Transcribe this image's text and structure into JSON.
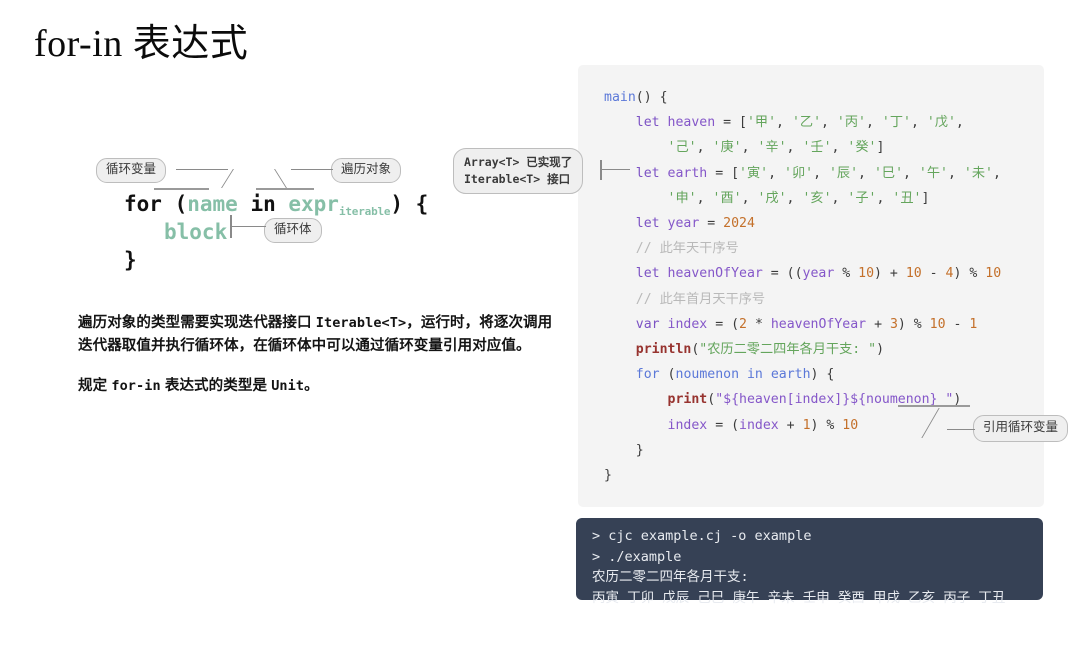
{
  "slide": {
    "title": "for-in 表达式"
  },
  "syntax_diagram": {
    "line1_pre": "for (",
    "line1_name": "name",
    "line1_mid": " in ",
    "line1_expr": "expr",
    "line1_sub": "iterable",
    "line1_post": ") {",
    "line2_block": "block",
    "line3_close": "}",
    "pill_loop_variable": "循环变量",
    "pill_iterable_object": "遍历对象",
    "pill_loop_body": "循环体"
  },
  "explanation": {
    "paragraph1_a": "遍历对象的类型需要实现迭代器接口 ",
    "paragraph1_mono": "Iterable<T>",
    "paragraph1_b": "，运行时，将逐次调用迭代器取值并执行循环体，在循环体中可以通过循环变量引用对应值。",
    "paragraph2_a": "规定 ",
    "paragraph2_mono1": "for-in",
    "paragraph2_b": " 表达式的类型是 ",
    "paragraph2_mono2": "Unit",
    "paragraph2_c": "。"
  },
  "annotations": {
    "array_note_line1": "Array<T> 已实现了",
    "array_note_line2": "Iterable<T> 接口",
    "ref_loop_variable": "引用循环变量"
  },
  "code": {
    "language": "cangjie",
    "lines": [
      "main() {",
      "    let heaven = ['甲', '乙', '丙', '丁', '戊',",
      "        '己', '庚', '辛', '壬', '癸']",
      "    let earth = ['寅', '卯', '辰', '巳', '午', '未',",
      "        '申', '酉', '戌', '亥', '子', '丑']",
      "    let year = 2024",
      "    // 此年天干序号",
      "    let heavenOfYear = ((year % 10) + 10 - 4) % 10",
      "    // 此年首月天干序号",
      "    var index = (2 * heavenOfYear + 3) % 10 - 1",
      "    println(\"农历二零二四年各月干支: \")",
      "    for (noumenon in earth) {",
      "        print(\"${heaven[index]}${noumenon} \")",
      "        index = (index + 1) % 10",
      "    }",
      "}"
    ]
  },
  "terminal": {
    "lines": [
      "> cjc example.cj -o example",
      "> ./example",
      "农历二零二四年各月干支:",
      "丙寅 丁卯 戊辰 己巳 庚午 辛未 壬申 癸酉 甲戌 乙亥 丙子 丁丑"
    ],
    "command1": "cjc example.cj -o example",
    "command2": "./example",
    "output_header": "农历二零二四年各月干支:",
    "output_values": "丙寅 丁卯 戊辰 己巳 庚午 辛未 壬申 癸酉 甲戌 乙亥 丙子 丁丑",
    "prompt": ">"
  },
  "colors": {
    "accent_green": "#86bfa7",
    "code_background": "#f4f4f4",
    "terminal_background": "#364155",
    "pill_background": "#efefef",
    "pill_border": "#bdbdbd",
    "keyword_purple": "#7c52c4",
    "identifier_blue": "#5b78d8",
    "string_green": "#64a55c",
    "number_orange": "#c4702a",
    "comment_gray": "#b9b9b9",
    "call_maroon": "#97332f"
  }
}
